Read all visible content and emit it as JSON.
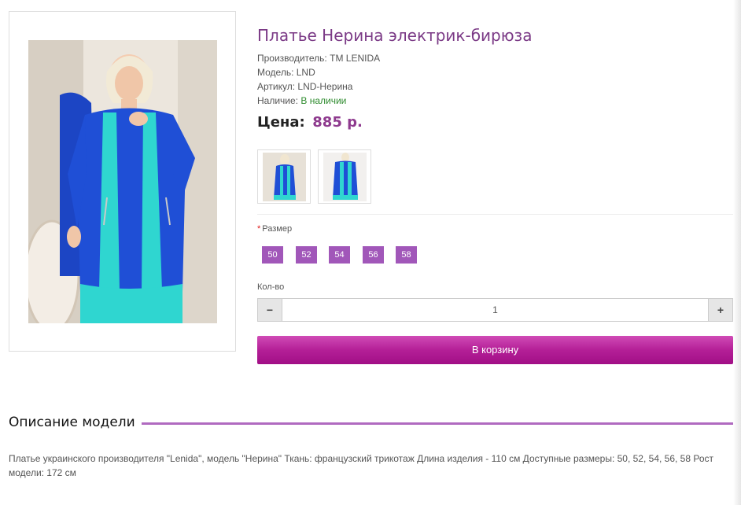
{
  "product": {
    "title": "Платье Нерина электрик-бирюза",
    "manufacturer_label": "Производитель:",
    "manufacturer_value": "TM LENIDA",
    "model_label": "Модель:",
    "model_value": "LND",
    "article_label": "Артикул:",
    "article_value": "LND-Нерина",
    "availability_label": "Наличие:",
    "availability_value": "В наличии",
    "price_label": "Цена:",
    "price_value": "885 р."
  },
  "options": {
    "size_required_mark": "*",
    "size_label": "Размер",
    "sizes": [
      "50",
      "52",
      "54",
      "56",
      "58"
    ],
    "quantity_label": "Кол-во",
    "quantity_value": "1",
    "minus_symbol": "−",
    "plus_symbol": "+",
    "add_to_cart_label": "В корзину"
  },
  "description": {
    "heading": "Описание модели",
    "text": "Платье украинского производителя \"Lenida\", модель \"Нерина\" Ткань: французский трикотаж Длина изделия - 110 см Доступные размеры: 50, 52, 54, 56, 58 Рост модели: 172 см"
  },
  "colors": {
    "accent_purple": "#a157b9",
    "title_purple": "#7b3a86",
    "cart_magenta": "#b41f97",
    "in_stock_green": "#2e8b2e",
    "dress_blue": "#1f4fd6",
    "dress_turquoise": "#2fd6d0"
  }
}
